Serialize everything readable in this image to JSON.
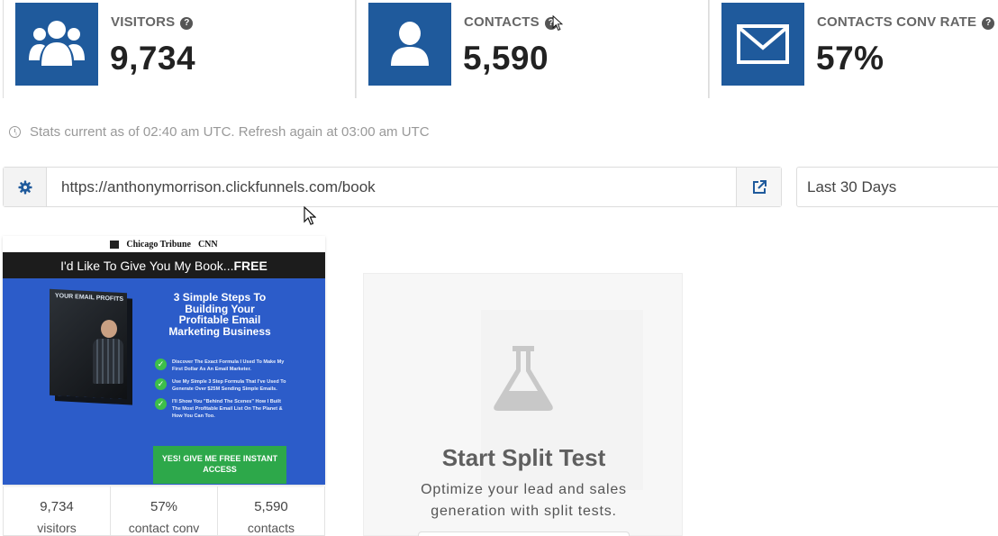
{
  "stats": [
    {
      "label": "VISITORS",
      "value": "9,734",
      "icon": "users-icon"
    },
    {
      "label": "CONTACTS",
      "value": "5,590",
      "icon": "user-icon"
    },
    {
      "label": "CONTACTS CONV RATE",
      "value": "57%",
      "icon": "envelope-icon"
    }
  ],
  "help_glyph": "?",
  "status_text": "Stats current as of 02:40 am UTC. Refresh again at 03:00 am UTC",
  "url": "https://anthonymorrison.clickfunnels.com/book",
  "date_range": "Last 30 Days",
  "thumbnail": {
    "press_1": "Chicago Tribune",
    "press_2": "CNN",
    "headline_prefix": "I'd Like To Give You My Book...",
    "headline_bold": "FREE",
    "book_title": "YOUR EMAIL PROFITS",
    "steps_title": "3 Simple Steps To Building Your Profitable Email Marketing Business",
    "bullets": [
      "Discover The Exact Formula I Used To Make My First Dollar As An Email Marketer.",
      "Use My Simple 3 Step Formula That I've Used To Generate Over $25M Sending Simple Emails.",
      "I'll Show You \"Behind The Scenes\" How I Built The Most Profitable Email List On The Planet & How You Can Too."
    ],
    "cta": "YES! GIVE ME FREE INSTANT ACCESS"
  },
  "thumb_stats": [
    {
      "value": "9,734",
      "label": "visitors"
    },
    {
      "value": "57%",
      "label": "contact conv"
    },
    {
      "value": "5,590",
      "label": "contacts"
    }
  ],
  "split_test": {
    "title": "Start Split Test",
    "description": "Optimize your lead and sales generation with split tests."
  },
  "colors": {
    "brand_blue": "#1f5a9c",
    "hero_blue": "#2c5cc9",
    "cta_green": "#2da84a"
  }
}
